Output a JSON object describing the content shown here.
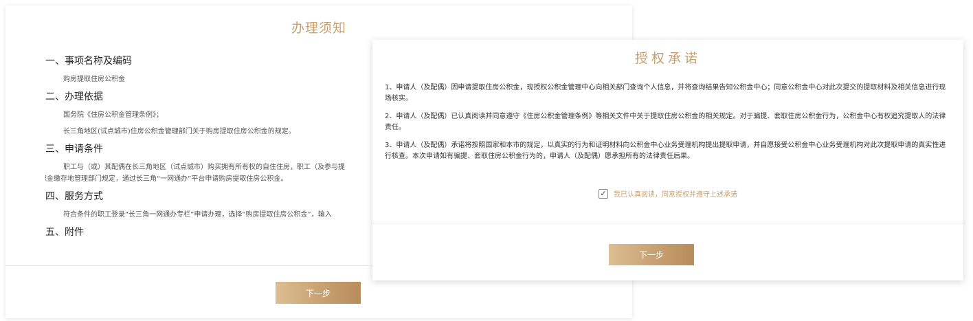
{
  "notice": {
    "title": "办理须知",
    "sections": [
      {
        "heading": "一、事项名称及编码",
        "lines": [
          "购房提取住房公积金"
        ]
      },
      {
        "heading": "二、办理依据",
        "lines": [
          "国务院《住房公积金管理条例》；",
          "长三角地区(试点城市)住房公积金管理部门关于购房提取住房公积金的规定。"
        ]
      },
      {
        "heading": "三、申请条件",
        "lines": [
          "职工与（或）其配偶在长三角地区（试点城市）购买拥有所有权的自住住房，职工（及参与提",
          "家和住房公积金缴存地管理部门规定，通过长三角“一网通办”平台申请购房提取住房公积金。"
        ]
      },
      {
        "heading": "四、服务方式",
        "lines": [
          "符合条件的职工登录“长三角一网通办专栏”申请办理，选择“购房提取住房公积金”，输入"
        ]
      },
      {
        "heading": "五、附件",
        "lines": []
      }
    ],
    "next_label": "下一步"
  },
  "promise": {
    "title": "授权承诺",
    "paragraphs": [
      "1、申请人（及配偶）因申请提取住房公积金，现授权公积金管理中心向相关部门查询个人信息，并将查询结果告知公积金中心；同意公积金中心对此次提交的提取材料及相关信息进行现场核实。",
      "2、申请人（及配偶）已认真阅读并同意遵守《住房公积金管理条例》等相关文件中关于提取住房公积金的相关规定。对于骗提、套取住房公积金行为，公积金中心有权追究提取人的法律责任。",
      "3、申请人（及配偶）承诺将按照国家和本市的规定，以真实的行为和证明材料向公积金中心业务受理机构提出提取申请，并自愿接受公积金中心业务受理机构对此次提取申请的真实性进行核查。本次申请如有骗提、套取住房公积金行为的，申请人（及配偶）愿承担所有的法律责任后果。"
    ],
    "agree_checked": true,
    "agree_label": "我已认真阅读，同意授权并遵守上述承诺",
    "next_label": "下一步"
  },
  "colors": {
    "accent": "#c8a06d",
    "button_start": "#dcbf93",
    "button_end": "#b88d5c"
  }
}
